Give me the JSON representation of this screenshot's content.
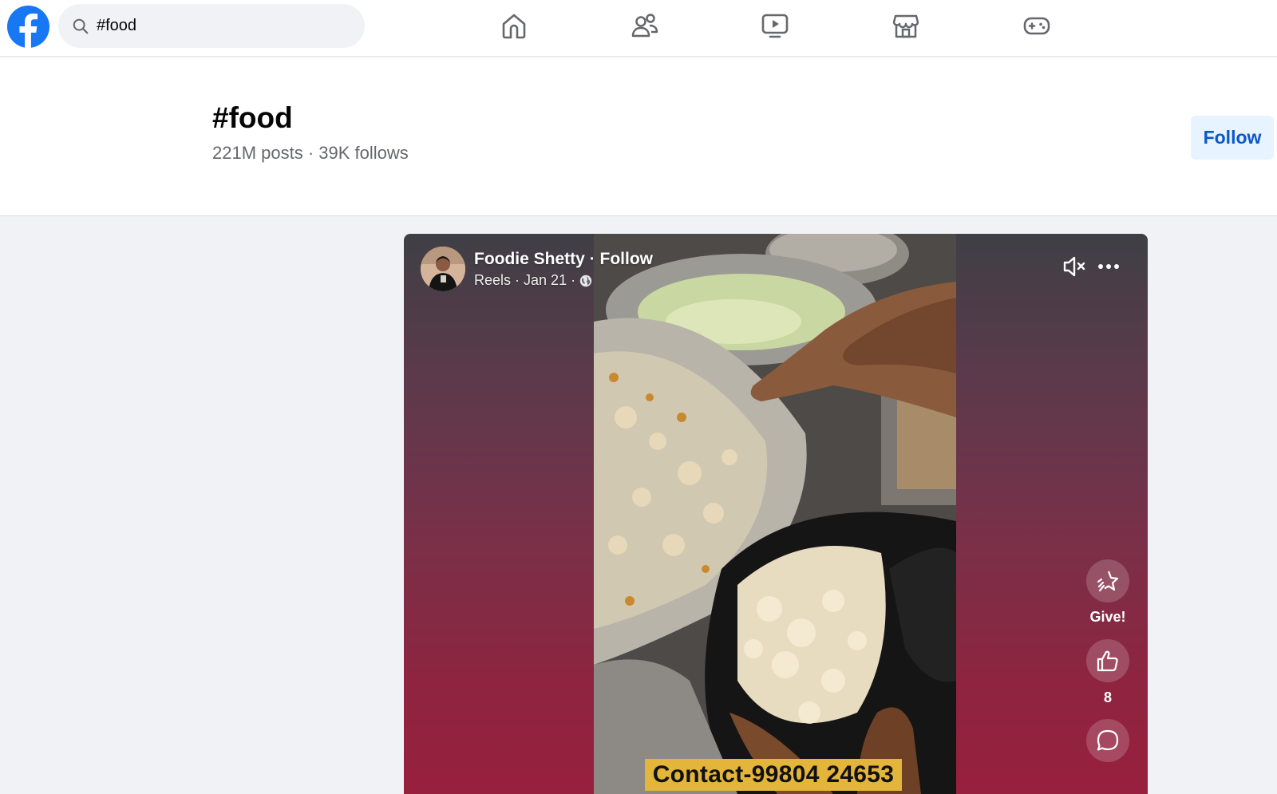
{
  "search": {
    "value": "#food"
  },
  "nav": {
    "icons": [
      "home-icon",
      "friends-icon",
      "watch-icon",
      "marketplace-icon",
      "gaming-icon"
    ]
  },
  "hashtag": {
    "title": "#food",
    "stats": "221M posts · 39K follows",
    "follow_label": "Follow"
  },
  "reel": {
    "author": "Foodie Shetty",
    "separator": " · ",
    "follow_label": "Follow",
    "type_label": "Reels",
    "date": "Jan 21",
    "caption": "Contact-99804 24653",
    "give_label": "Give!",
    "like_count": "8"
  },
  "colors": {
    "brand": "#1877f2",
    "follow_bg": "#e7f3ff",
    "follow_text": "#0a58ca",
    "caption_bg": "#e3b53b"
  }
}
